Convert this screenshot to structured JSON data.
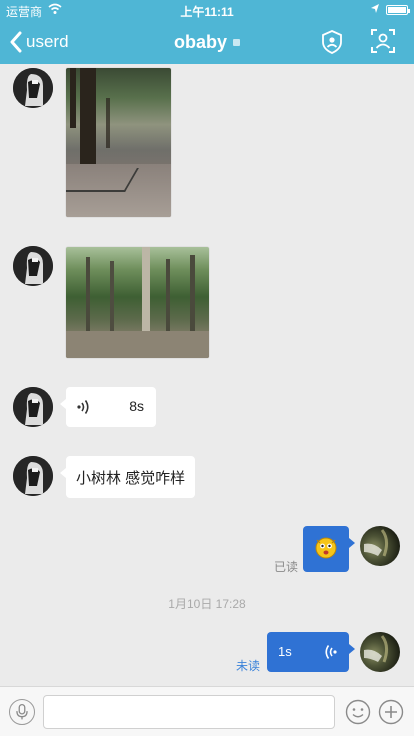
{
  "status_bar": {
    "carrier": "运营商",
    "time": "上午11:11"
  },
  "nav": {
    "back_label": "userd",
    "title": "obaby"
  },
  "messages": {
    "voice_in_duration": "8s",
    "text_in": "小树林 感觉咋样",
    "read_label": "已读",
    "timestamp": "1月10日 17:28",
    "voice_out_duration": "1s",
    "unread_label": "未读"
  },
  "input": {
    "value": ""
  },
  "colors": {
    "header": "#4fb6d5",
    "outgoing_bubble": "#2f72d4",
    "background": "#ebebeb"
  }
}
